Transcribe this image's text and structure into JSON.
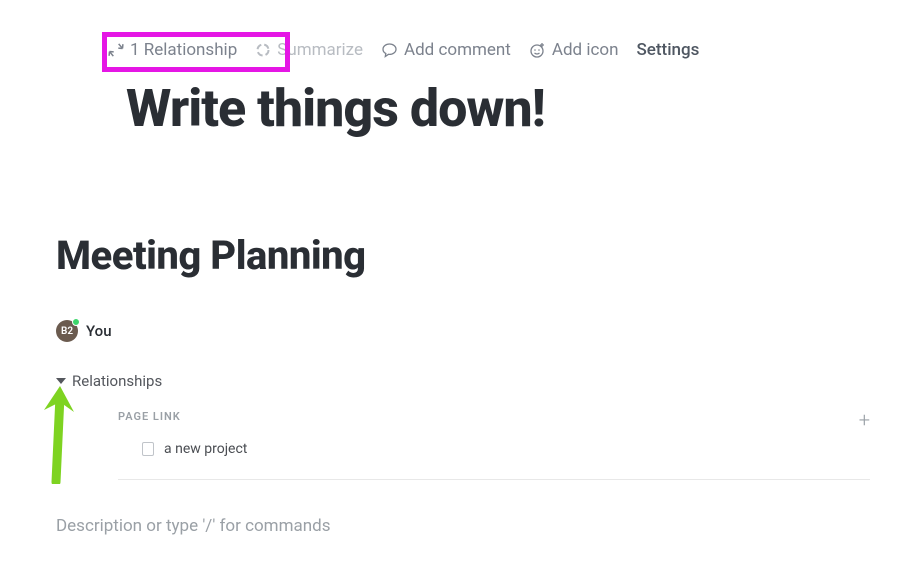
{
  "toolbar": {
    "relationship": {
      "text": "1 Relationship"
    },
    "summarize": {
      "text": "Summarize"
    },
    "addComment": {
      "text": "Add comment"
    },
    "addIcon": {
      "text": "Add icon"
    },
    "settings": {
      "text": "Settings"
    }
  },
  "hero": {
    "title": "Write things down!"
  },
  "page": {
    "title": "Meeting Planning"
  },
  "author": {
    "initials": "B2",
    "name": "You"
  },
  "relationships": {
    "header": "Relationships",
    "section_label": "PAGE LINK",
    "items": [
      {
        "title": "a new project"
      }
    ]
  },
  "editor": {
    "placeholder": "Description or type '/' for commands"
  },
  "annotation": {
    "highlight_color": "#e516e5",
    "arrow_color": "#7ed321"
  }
}
